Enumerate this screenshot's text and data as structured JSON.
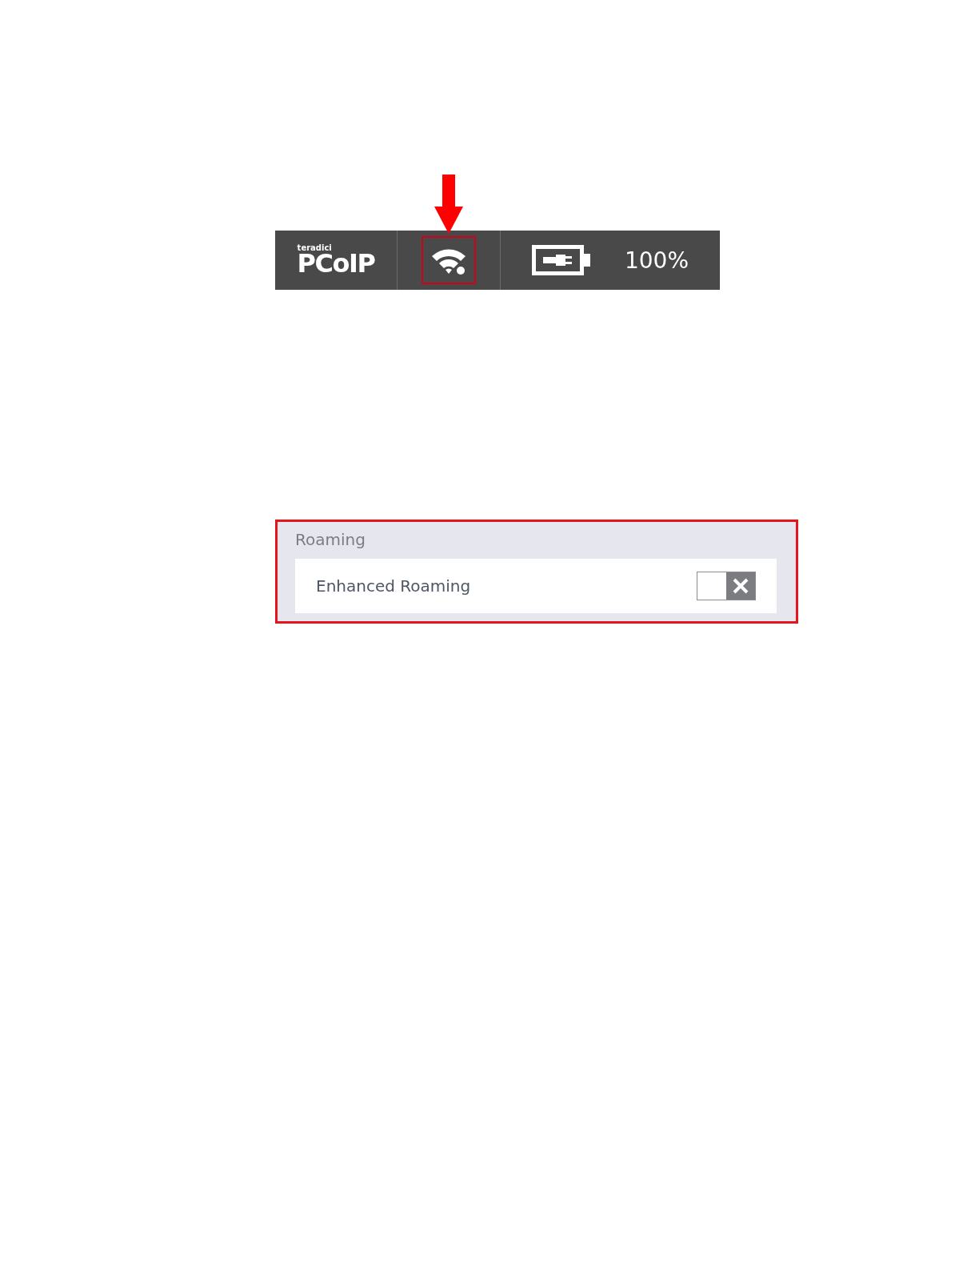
{
  "toolbar": {
    "logo_small": "teradici",
    "logo": "PCoIP",
    "battery_reading": "100%"
  },
  "roaming": {
    "title": "Roaming",
    "settings": [
      {
        "label": "Enhanced Roaming",
        "on": false
      }
    ]
  }
}
